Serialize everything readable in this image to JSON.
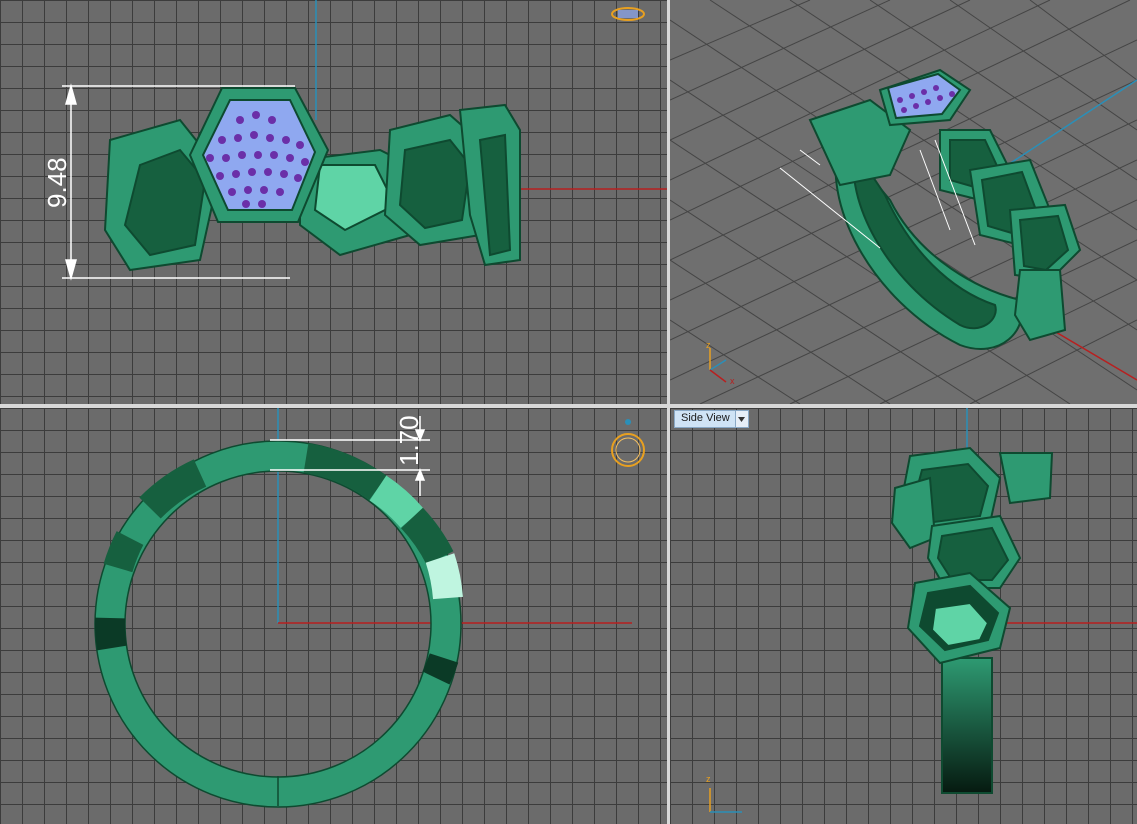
{
  "viewports": {
    "front": {
      "dimension_label": "9.48"
    },
    "top": {
      "dimension_label": "1.70"
    },
    "side": {
      "view_label": "Side View",
      "dropdown_icon": "chevron-down-icon"
    }
  },
  "axis_tripod": {
    "z": "z",
    "x": "x"
  },
  "colors": {
    "ring_green": "#2e9a72",
    "ring_dark": "#16603f",
    "gem_purple": "#6b2fa8",
    "gem_plate": "#8fa8f0",
    "axis_red": "#b82020",
    "axis_blue": "#2a8fb8",
    "grid_dark": "#3c3c3c",
    "viewcube_orange": "#e8a020"
  }
}
